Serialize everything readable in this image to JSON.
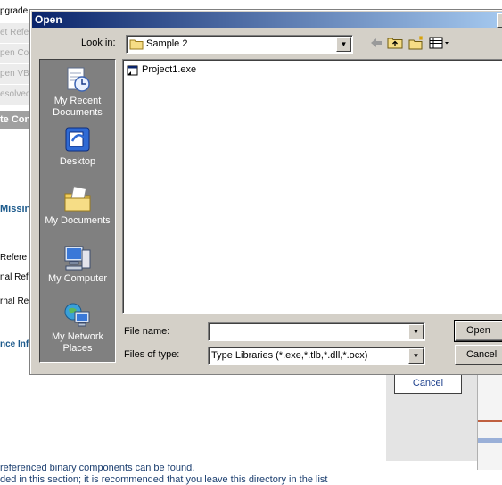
{
  "background": {
    "left_items": [
      "pgrade",
      "et Refe",
      "pen Co",
      "pen VB",
      "esolved"
    ],
    "section_header": "te Con",
    "left_labels": [
      "Missin",
      "Refere",
      "nal Ref",
      "rnal Re",
      "nce Inf"
    ],
    "cancel_label": "Cancel",
    "note_line1": "referenced binary components can be found.",
    "note_line2": "ded in this section; it is recommended that you leave this directory in the list"
  },
  "dialog": {
    "title": "Open",
    "look_in_label": "Look in:",
    "look_in_value": "Sample 2",
    "toolbar_icons": [
      "back-arrow-icon",
      "up-folder-icon",
      "new-folder-icon",
      "view-menu-icon"
    ],
    "places": [
      {
        "label": "My Recent Documents",
        "icon": "recent-documents-icon"
      },
      {
        "label": "Desktop",
        "icon": "desktop-icon"
      },
      {
        "label": "My Documents",
        "icon": "my-documents-icon"
      },
      {
        "label": "My Computer",
        "icon": "my-computer-icon"
      },
      {
        "label": "My Network Places",
        "icon": "network-places-icon"
      }
    ],
    "files": [
      {
        "name": "Project1.exe",
        "icon": "exe-file-icon"
      }
    ],
    "file_name_label": "File name:",
    "file_name_value": "",
    "files_of_type_label": "Files of type:",
    "files_of_type_value": "Type Libraries (*.exe,*.tlb,*.dll,*.ocx)",
    "open_button": "Open",
    "cancel_button": "Cancel"
  }
}
